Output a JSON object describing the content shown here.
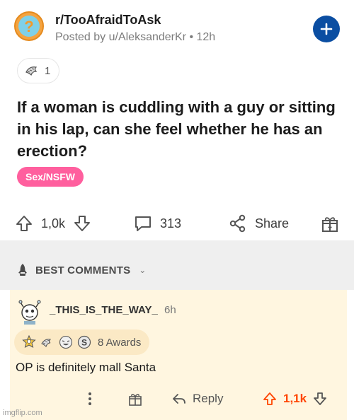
{
  "post": {
    "subreddit": "r/TooAfraidToAsk",
    "posted_by": "Posted by u/AleksanderKr • 12h",
    "award_count": "1",
    "title": "If a woman is cuddling with a guy or sitting in his lap, can she feel whether he has an erection?",
    "flair": "Sex/NSFW",
    "upvotes": "1,0k",
    "comments": "313",
    "share_label": "Share"
  },
  "sort": {
    "label": "BEST COMMENTS",
    "chevron": "⌄"
  },
  "comment": {
    "author": "_THIS_IS_THE_WAY_",
    "time": "6h",
    "awards_label": "8 Awards",
    "body": "OP is definitely mall Santa",
    "reply_label": "Reply",
    "score": "1,1k"
  },
  "watermark": "imgflip.com",
  "colors": {
    "flair_bg": "#ff5f9e",
    "join_btn": "#0b4ea2",
    "upvote_orange": "#ff4500",
    "comment_bg": "#fff6e0"
  }
}
